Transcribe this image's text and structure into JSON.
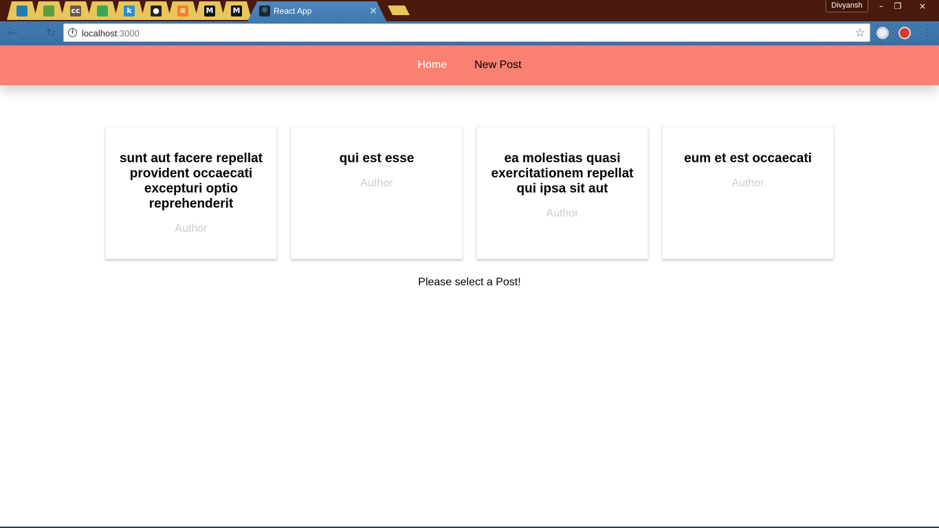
{
  "browser": {
    "pinned_tabs": [
      {
        "icon": "bird-icon",
        "glyph": "",
        "color": "#1e7fb5"
      },
      {
        "icon": "nodejs-hexagon-icon",
        "glyph": "",
        "color": "#5a9f3c"
      },
      {
        "icon": "cc-icon",
        "glyph": "cc",
        "color": "#6b5a48"
      },
      {
        "icon": "drive-icon",
        "glyph": "",
        "color": "#3aa757"
      },
      {
        "icon": "k-letter-icon",
        "glyph": "k",
        "color": "#2b8dd6"
      },
      {
        "icon": "github-icon",
        "glyph": "●",
        "color": "#222222"
      },
      {
        "icon": "stackoverflow-icon",
        "glyph": "≡",
        "color": "#f48024"
      },
      {
        "icon": "medium-m-icon",
        "glyph": "M",
        "color": "#111111"
      },
      {
        "icon": "medium-m-icon",
        "glyph": "M",
        "color": "#111111"
      }
    ],
    "active_tab": {
      "title": "React App",
      "icon": "react-atom-icon",
      "close_glyph": "×"
    },
    "profile_name": "Divyansh",
    "window_controls": {
      "minimize": "–",
      "maximize": "❐",
      "close": "×"
    },
    "toolbar": {
      "back_glyph": "←",
      "reload_glyph": "↻",
      "url_host": "localhost",
      "url_port": ":3000",
      "info_glyph": "i",
      "star_glyph": "☆",
      "menu_glyph": "⋮"
    }
  },
  "app": {
    "nav": {
      "home": "Home",
      "new_post": "New Post"
    },
    "posts": [
      {
        "title": "sunt aut facere repellat provident occaecati excepturi optio reprehenderit",
        "author": "Author"
      },
      {
        "title": "qui est esse",
        "author": "Author"
      },
      {
        "title": "ea molestias quasi exercitationem repellat qui ipsa sit aut",
        "author": "Author"
      },
      {
        "title": "eum et est occaecati",
        "author": "Author"
      }
    ],
    "select_message": "Please select a Post!",
    "colors": {
      "nav_background": "#fa8072",
      "author_text": "#cccccc"
    }
  }
}
